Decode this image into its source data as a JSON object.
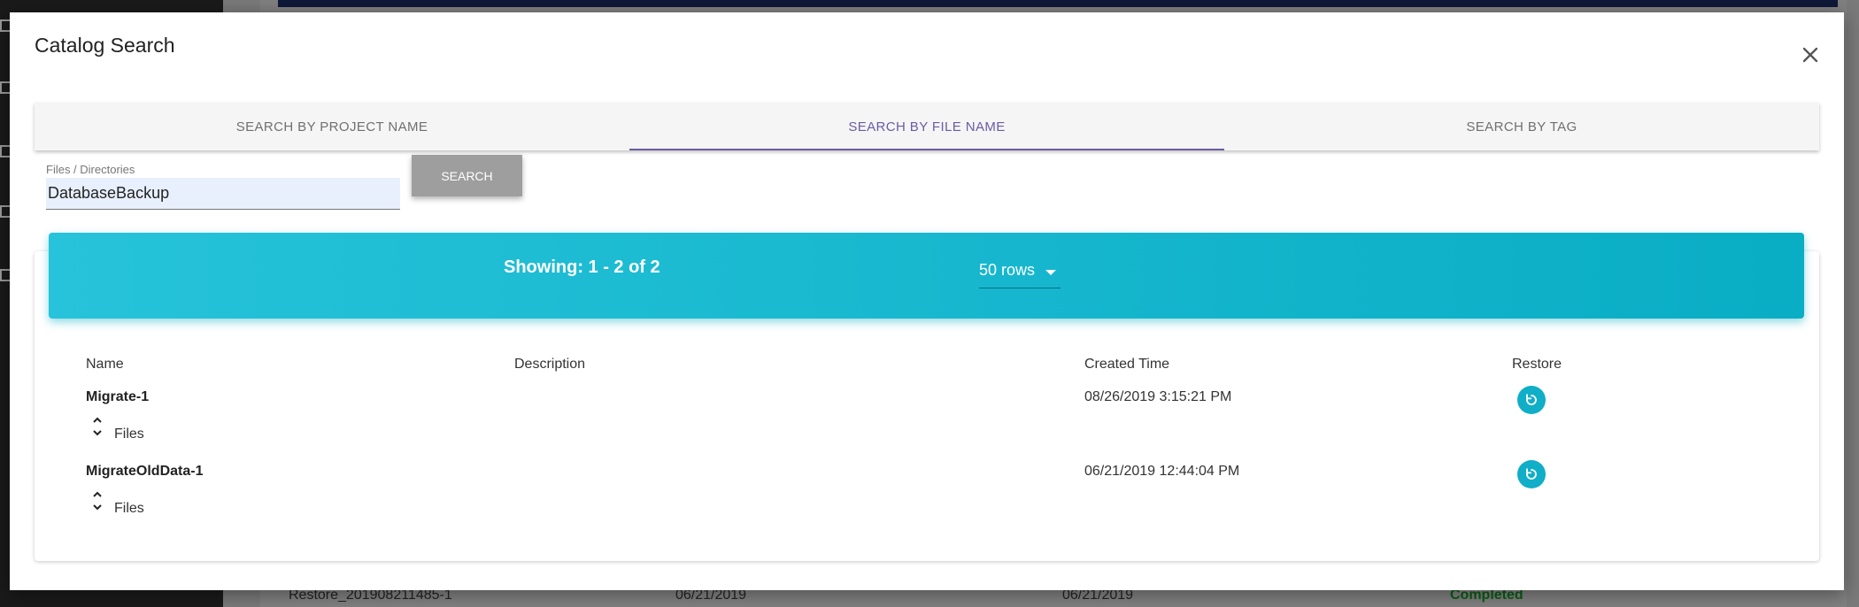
{
  "background": {
    "rows": [
      "Restore_201908211485-1",
      "06/21/2019",
      "06/21/2019",
      "Completed"
    ]
  },
  "modal": {
    "title": "Catalog Search",
    "close_icon": "close-icon"
  },
  "tabs": [
    {
      "label": "SEARCH BY PROJECT NAME",
      "active": false
    },
    {
      "label": "SEARCH BY FILE NAME",
      "active": true
    },
    {
      "label": "SEARCH BY TAG",
      "active": false
    }
  ],
  "search": {
    "label": "Files / Directories",
    "value": "DatabaseBackup",
    "button": "SEARCH"
  },
  "results": {
    "showing": "Showing: 1 - 2 of 2",
    "rows_per_page": "50 rows",
    "columns": [
      "Name",
      "Description",
      "Created Time",
      "Restore"
    ],
    "rows": [
      {
        "name": "Migrate-1",
        "description": "",
        "created": "08/26/2019 3:15:21 PM",
        "files_label": "Files"
      },
      {
        "name": "MigrateOldData-1",
        "description": "",
        "created": "06/21/2019 12:44:04 PM",
        "files_label": "Files"
      }
    ]
  },
  "colors": {
    "accent": "#6b5ca5",
    "header": "#09adc4",
    "restore": "#10aec7"
  }
}
